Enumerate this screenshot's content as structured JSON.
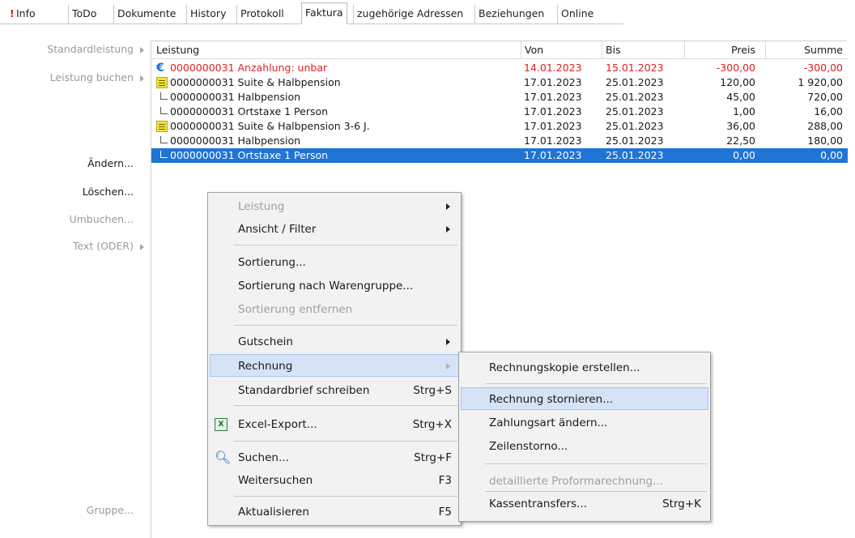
{
  "tabs": [
    {
      "label": "Info"
    },
    {
      "label": "ToDo"
    },
    {
      "label": "Dokumente"
    },
    {
      "label": "History"
    },
    {
      "label": "Protokoll"
    },
    {
      "label": "Faktura",
      "active": true
    },
    {
      "label": "zugehörige Adressen"
    },
    {
      "label": "Beziehungen"
    },
    {
      "label": "Online"
    }
  ],
  "side": {
    "standardleistung": "Standardleistung",
    "leistung_buchen": "Leistung buchen",
    "aendern": "Ändern...",
    "loeschen": "Löschen...",
    "umbuchen": "Umbuchen...",
    "text_oder": "Text (ODER)",
    "gruppe": "Gruppe..."
  },
  "grid": {
    "headers": {
      "leistung": "Leistung",
      "von": "Von",
      "bis": "Bis",
      "preis": "Preis",
      "summe": "Summe"
    },
    "rows": [
      {
        "icon": "euro-icon",
        "text": "0000000031  Anzahlung: unbar",
        "von": "14.01.2023",
        "bis": "15.01.2023",
        "preis": "-300,00",
        "summe": "-300,00",
        "red": true
      },
      {
        "icon": "list-icon",
        "text": "0000000031  Suite & Halbpension",
        "von": "17.01.2023",
        "bis": "25.01.2023",
        "preis": "120,00",
        "summe": "1 920,00"
      },
      {
        "icon": "child-icon",
        "text": "0000000031  Halbpension",
        "von": "17.01.2023",
        "bis": "25.01.2023",
        "preis": "45,00",
        "summe": "720,00"
      },
      {
        "icon": "child-icon",
        "text": "0000000031  Ortstaxe 1 Person",
        "von": "17.01.2023",
        "bis": "25.01.2023",
        "preis": "1,00",
        "summe": "16,00"
      },
      {
        "icon": "list-icon",
        "text": "0000000031  Suite & Halbpension 3-6 J.",
        "von": "17.01.2023",
        "bis": "25.01.2023",
        "preis": "36,00",
        "summe": "288,00"
      },
      {
        "icon": "child-icon",
        "text": "0000000031  Halbpension",
        "von": "17.01.2023",
        "bis": "25.01.2023",
        "preis": "22,50",
        "summe": "180,00"
      },
      {
        "icon": "child-icon",
        "text": "0000000031  Ortstaxe 1 Person",
        "von": "17.01.2023",
        "bis": "25.01.2023",
        "preis": "0,00",
        "summe": "0,00",
        "selected": true
      }
    ]
  },
  "context_menu": {
    "leistung": "Leistung",
    "ansicht_filter": "Ansicht / Filter",
    "sortierung": "Sortierung...",
    "sortierung_warengruppe": "Sortierung nach Warengruppe...",
    "sortierung_entfernen": "Sortierung entfernen",
    "gutschein": "Gutschein",
    "rechnung": "Rechnung",
    "standardbrief": "Standardbrief schreiben",
    "standardbrief_sc": "Strg+S",
    "excel_export": "Excel-Export...",
    "excel_export_sc": "Strg+X",
    "suchen": "Suchen...",
    "suchen_sc": "Strg+F",
    "weitersuchen": "Weitersuchen",
    "weitersuchen_sc": "F3",
    "aktualisieren": "Aktualisieren",
    "aktualisieren_sc": "F5"
  },
  "submenu": {
    "rechnungskopie": "Rechnungskopie erstellen...",
    "stornieren": "Rechnung stornieren...",
    "zahlungsart": "Zahlungsart ändern...",
    "zeilenstorno": "Zeilenstorno...",
    "proforma": "detaillierte Proformarechnung...",
    "kassentransfers": "Kassentransfers...",
    "kassentransfers_sc": "Strg+K"
  },
  "colors": {
    "selection": "#1f74d6",
    "negative": "#e01e1e",
    "menu_hover": "#d5e3f7"
  }
}
